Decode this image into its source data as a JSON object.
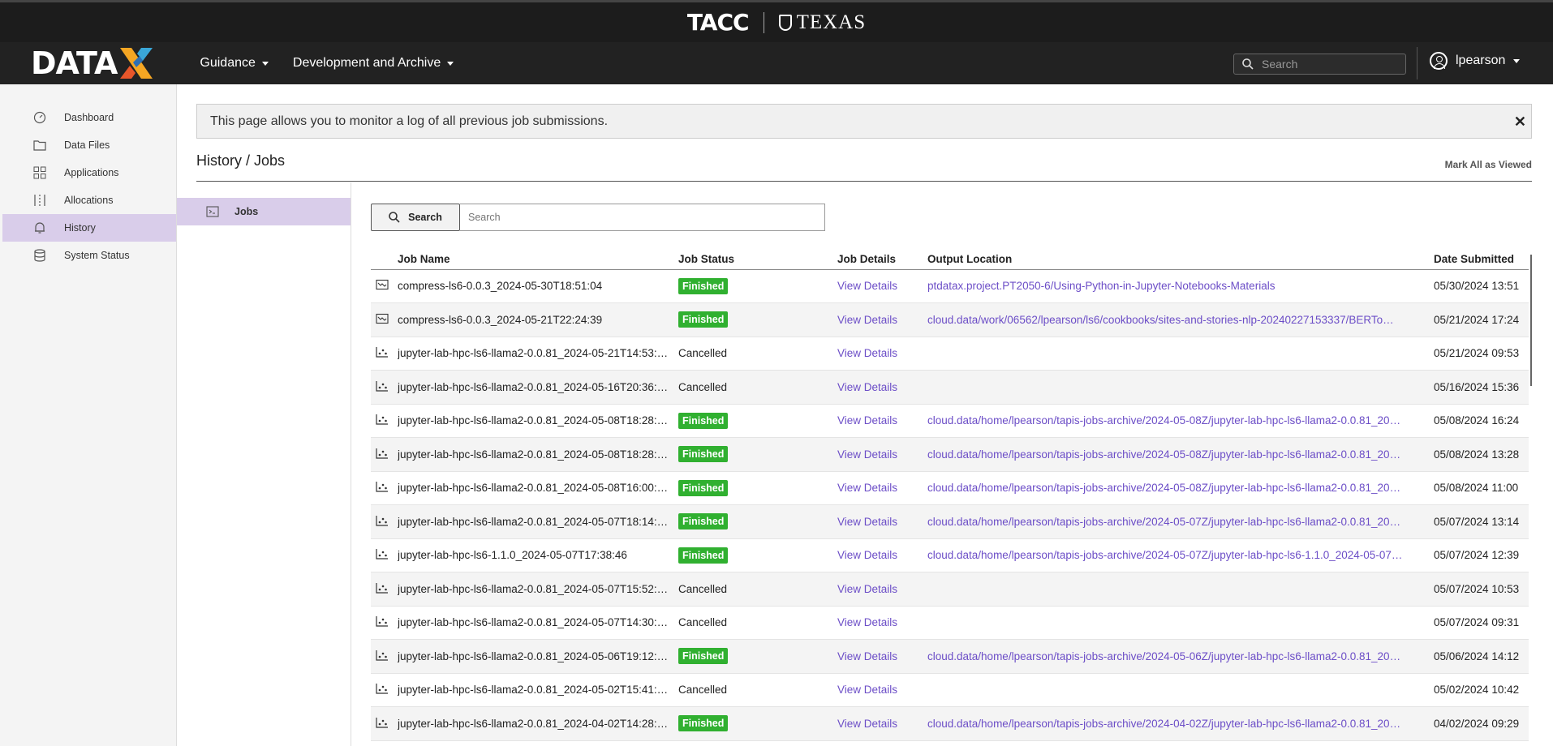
{
  "topbar": {
    "tacc": "TACC",
    "texas": "TEXAS"
  },
  "nav": {
    "brand": "DATA",
    "menus": [
      {
        "label": "Guidance"
      },
      {
        "label": "Development and Archive"
      }
    ],
    "search_placeholder": "Search",
    "user": "lpearson"
  },
  "sidebar": {
    "items": [
      {
        "label": "Dashboard",
        "icon": "dashboard-icon"
      },
      {
        "label": "Data Files",
        "icon": "folder-icon"
      },
      {
        "label": "Applications",
        "icon": "grid-icon"
      },
      {
        "label": "Allocations",
        "icon": "allocations-icon"
      },
      {
        "label": "History",
        "icon": "bell-icon"
      },
      {
        "label": "System Status",
        "icon": "database-icon"
      }
    ],
    "active": "History"
  },
  "notice": {
    "text": "This page allows you to monitor a log of all previous job submissions.",
    "close": "✕"
  },
  "page": {
    "title": "History / Jobs",
    "mark_all": "Mark All as Viewed"
  },
  "subnav": {
    "item": "Jobs"
  },
  "search": {
    "button": "Search",
    "placeholder": "Search"
  },
  "table": {
    "headers": [
      "Job Name",
      "Job Status",
      "Job Details",
      "Output Location",
      "Date Submitted"
    ],
    "rows": [
      {
        "icon": "compress-icon",
        "name": "compress-ls6-0.0.3_2024-05-30T18:51:04",
        "status": "Finished",
        "details": "View Details",
        "output": "ptdatax.project.PT2050-6/Using-Python-in-Jupyter-Notebooks-Materials",
        "date": "05/30/2024 13:51"
      },
      {
        "icon": "compress-icon",
        "name": "compress-ls6-0.0.3_2024-05-21T22:24:39",
        "status": "Finished",
        "details": "View Details",
        "output": "cloud.data/work/06562/lpearson/ls6/cookbooks/sites-and-stories-nlp-20240227153337/BERTo…",
        "date": "05/21/2024 17:24"
      },
      {
        "icon": "jupyter-icon",
        "name": "jupyter-lab-hpc-ls6-llama2-0.0.81_2024-05-21T14:53:…",
        "status": "Cancelled",
        "details": "View Details",
        "output": "",
        "date": "05/21/2024 09:53"
      },
      {
        "icon": "jupyter-icon",
        "name": "jupyter-lab-hpc-ls6-llama2-0.0.81_2024-05-16T20:36:…",
        "status": "Cancelled",
        "details": "View Details",
        "output": "",
        "date": "05/16/2024 15:36"
      },
      {
        "icon": "jupyter-icon",
        "name": "jupyter-lab-hpc-ls6-llama2-0.0.81_2024-05-08T18:28:…",
        "status": "Finished",
        "details": "View Details",
        "output": "cloud.data/home/lpearson/tapis-jobs-archive/2024-05-08Z/jupyter-lab-hpc-ls6-llama2-0.0.81_20…",
        "date": "05/08/2024 16:24"
      },
      {
        "icon": "jupyter-icon",
        "name": "jupyter-lab-hpc-ls6-llama2-0.0.81_2024-05-08T18:28:…",
        "status": "Finished",
        "details": "View Details",
        "output": "cloud.data/home/lpearson/tapis-jobs-archive/2024-05-08Z/jupyter-lab-hpc-ls6-llama2-0.0.81_20…",
        "date": "05/08/2024 13:28"
      },
      {
        "icon": "jupyter-icon",
        "name": "jupyter-lab-hpc-ls6-llama2-0.0.81_2024-05-08T16:00:…",
        "status": "Finished",
        "details": "View Details",
        "output": "cloud.data/home/lpearson/tapis-jobs-archive/2024-05-08Z/jupyter-lab-hpc-ls6-llama2-0.0.81_20…",
        "date": "05/08/2024 11:00"
      },
      {
        "icon": "jupyter-icon",
        "name": "jupyter-lab-hpc-ls6-llama2-0.0.81_2024-05-07T18:14:…",
        "status": "Finished",
        "details": "View Details",
        "output": "cloud.data/home/lpearson/tapis-jobs-archive/2024-05-07Z/jupyter-lab-hpc-ls6-llama2-0.0.81_20…",
        "date": "05/07/2024 13:14"
      },
      {
        "icon": "jupyter-icon",
        "name": "jupyter-lab-hpc-ls6-1.1.0_2024-05-07T17:38:46",
        "status": "Finished",
        "details": "View Details",
        "output": "cloud.data/home/lpearson/tapis-jobs-archive/2024-05-07Z/jupyter-lab-hpc-ls6-1.1.0_2024-05-07…",
        "date": "05/07/2024 12:39"
      },
      {
        "icon": "jupyter-icon",
        "name": "jupyter-lab-hpc-ls6-llama2-0.0.81_2024-05-07T15:52:…",
        "status": "Cancelled",
        "details": "View Details",
        "output": "",
        "date": "05/07/2024 10:53"
      },
      {
        "icon": "jupyter-icon",
        "name": "jupyter-lab-hpc-ls6-llama2-0.0.81_2024-05-07T14:30:…",
        "status": "Cancelled",
        "details": "View Details",
        "output": "",
        "date": "05/07/2024 09:31"
      },
      {
        "icon": "jupyter-icon",
        "name": "jupyter-lab-hpc-ls6-llama2-0.0.81_2024-05-06T19:12:…",
        "status": "Finished",
        "details": "View Details",
        "output": "cloud.data/home/lpearson/tapis-jobs-archive/2024-05-06Z/jupyter-lab-hpc-ls6-llama2-0.0.81_20…",
        "date": "05/06/2024 14:12"
      },
      {
        "icon": "jupyter-icon",
        "name": "jupyter-lab-hpc-ls6-llama2-0.0.81_2024-05-02T15:41:…",
        "status": "Cancelled",
        "details": "View Details",
        "output": "",
        "date": "05/02/2024 10:42"
      },
      {
        "icon": "jupyter-icon",
        "name": "jupyter-lab-hpc-ls6-llama2-0.0.81_2024-04-02T14:28:…",
        "status": "Finished",
        "details": "View Details",
        "output": "cloud.data/home/lpearson/tapis-jobs-archive/2024-04-02Z/jupyter-lab-hpc-ls6-llama2-0.0.81_20…",
        "date": "04/02/2024 09:29"
      }
    ]
  },
  "colors": {
    "accent": "#6c4ec7",
    "active_bg": "#d9cdea",
    "finished": "#30b030",
    "nav_bg": "#222222"
  }
}
